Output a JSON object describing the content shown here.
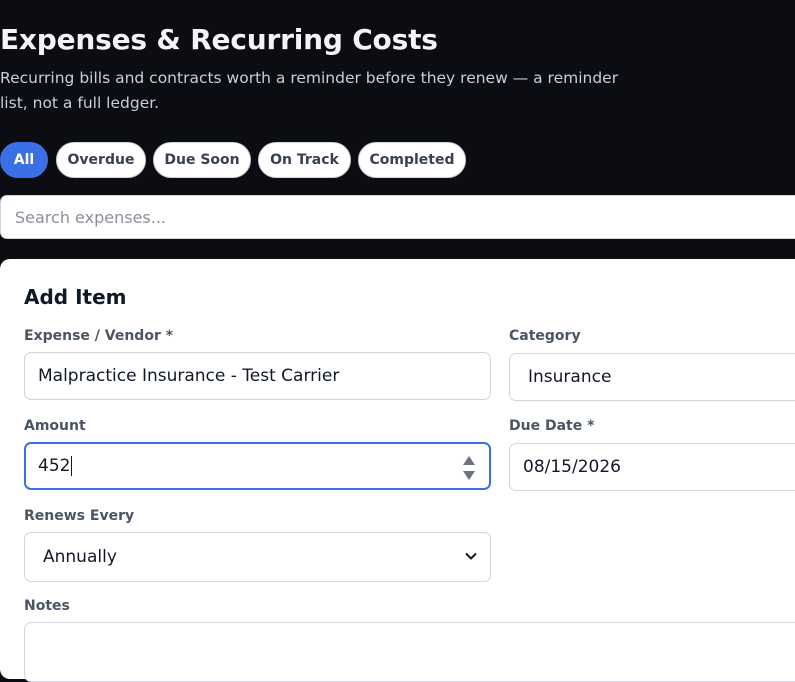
{
  "header": {
    "title": "Expenses & Recurring Costs",
    "subtitle": "Recurring bills and contracts worth a reminder before they renew — a reminder list, not a full ledger."
  },
  "filters": [
    {
      "label": "All",
      "active": true
    },
    {
      "label": "Overdue",
      "active": false
    },
    {
      "label": "Due Soon",
      "active": false
    },
    {
      "label": "On Track",
      "active": false
    },
    {
      "label": "Completed",
      "active": false
    }
  ],
  "search": {
    "placeholder": "Search expenses..."
  },
  "form": {
    "title": "Add Item",
    "vendor": {
      "label": "Expense / Vendor *",
      "value": "Malpractice Insurance - Test Carrier"
    },
    "category": {
      "label": "Category",
      "value": "Insurance"
    },
    "amount": {
      "label": "Amount",
      "value": "452"
    },
    "due_date": {
      "label": "Due Date *",
      "value": "08/15/2026"
    },
    "renews": {
      "label": "Renews Every",
      "value": "Annually"
    },
    "notes": {
      "label": "Notes"
    }
  },
  "colors": {
    "background": "#0b0d12",
    "accent": "#3b6fe6",
    "card": "#ffffff"
  }
}
